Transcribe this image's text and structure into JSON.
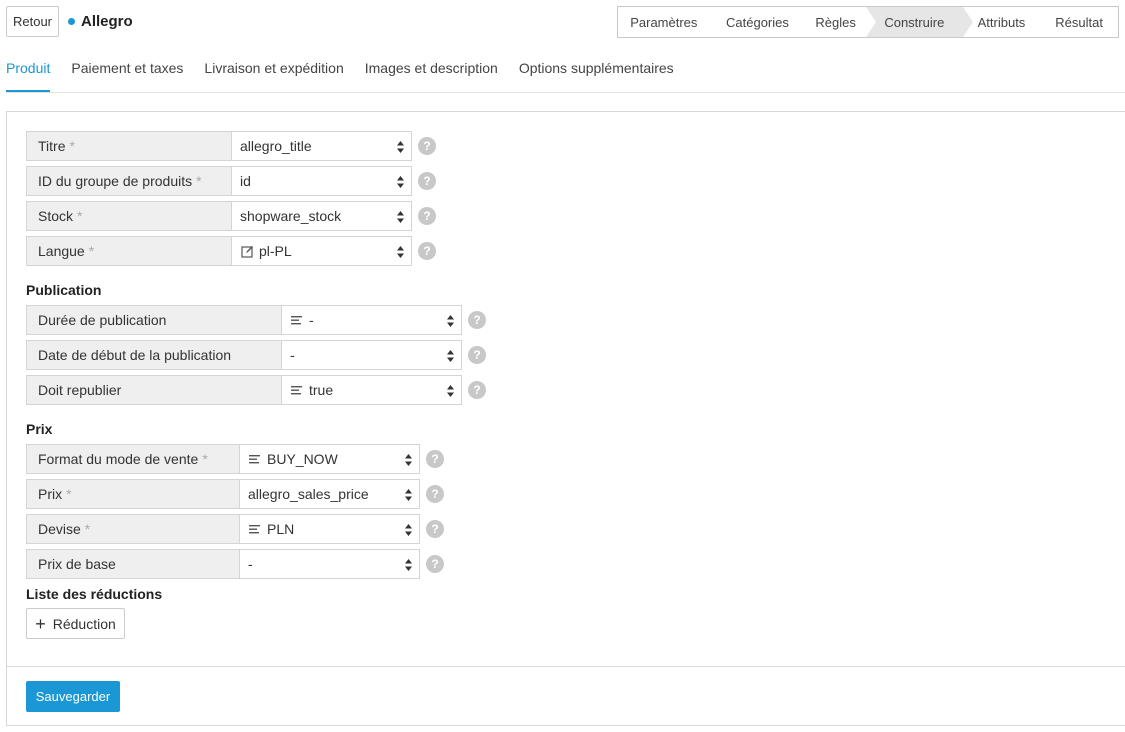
{
  "header": {
    "back_label": "Retour",
    "title": "Allegro",
    "dot_color": "#1a97d4"
  },
  "steps": [
    {
      "label": "Paramètres",
      "active": false
    },
    {
      "label": "Catégories",
      "active": false
    },
    {
      "label": "Règles",
      "active": false
    },
    {
      "label": "Construire",
      "active": true
    },
    {
      "label": "Attributs",
      "active": false
    },
    {
      "label": "Résultat",
      "active": false
    }
  ],
  "tabs": [
    {
      "label": "Produit",
      "active": true
    },
    {
      "label": "Paiement et taxes",
      "active": false
    },
    {
      "label": "Livraison et expédition",
      "active": false
    },
    {
      "label": "Images et description",
      "active": false
    },
    {
      "label": "Options supplémentaires",
      "active": false
    }
  ],
  "product_fields": [
    {
      "label": "Titre",
      "required": true,
      "value": "allegro_title",
      "icon": null
    },
    {
      "label": "ID du groupe de produits",
      "required": true,
      "value": "id",
      "icon": null
    },
    {
      "label": "Stock",
      "required": true,
      "value": "shopware_stock",
      "icon": null
    },
    {
      "label": "Langue",
      "required": true,
      "value": "pl-PL",
      "icon": "edit-icon"
    }
  ],
  "publication": {
    "title": "Publication",
    "fields": [
      {
        "label": "Durée de publication",
        "required": false,
        "value": "-",
        "icon": "text-lines-icon"
      },
      {
        "label": "Date de début de la publication",
        "required": false,
        "value": "-",
        "icon": null
      },
      {
        "label": "Doit republier",
        "required": false,
        "value": "true",
        "icon": "text-lines-icon"
      }
    ]
  },
  "price": {
    "title": "Prix",
    "fields": [
      {
        "label": "Format du mode de vente",
        "required": true,
        "value": "BUY_NOW",
        "icon": "text-lines-icon"
      },
      {
        "label": "Prix",
        "required": true,
        "value": "allegro_sales_price",
        "icon": null
      },
      {
        "label": "Devise",
        "required": true,
        "value": "PLN",
        "icon": "text-lines-icon"
      },
      {
        "label": "Prix de base",
        "required": false,
        "value": "-",
        "icon": null
      }
    ]
  },
  "discounts": {
    "title": "Liste des réductions",
    "add_label": "Réduction"
  },
  "required_marker": "*",
  "help_glyph": "?",
  "save_label": "Sauvegarder",
  "colors": {
    "accent": "#1a97d4",
    "label_bg": "#efefef",
    "help_bg": "#c8c8c8"
  }
}
